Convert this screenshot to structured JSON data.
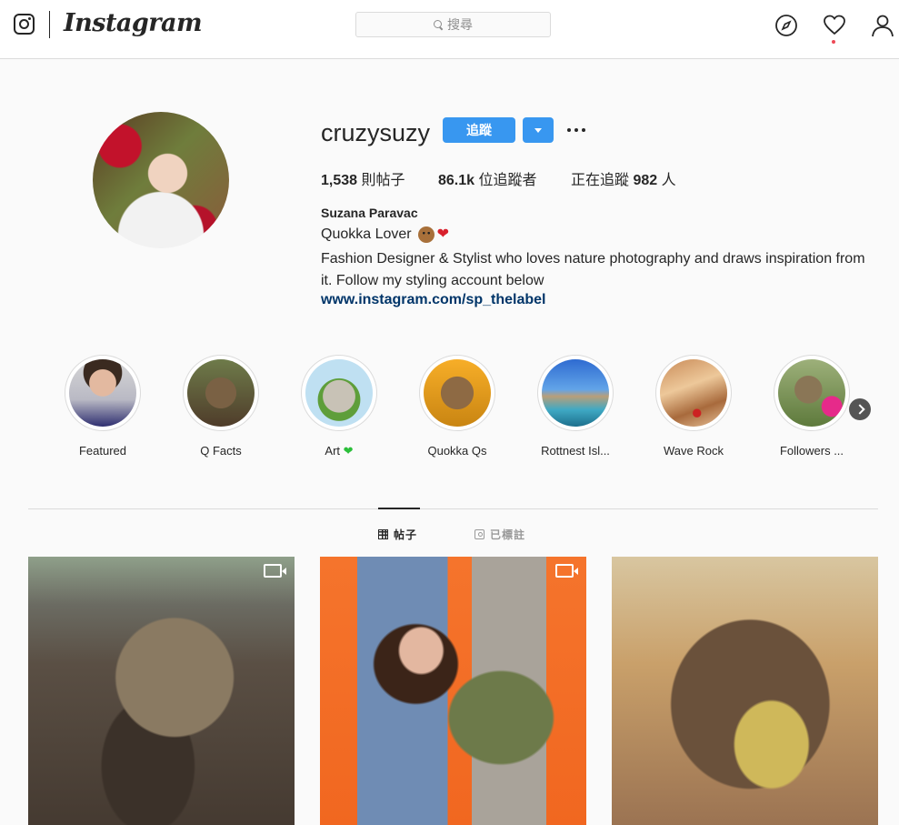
{
  "nav": {
    "brand": "Instagram",
    "search_placeholder": "搜尋"
  },
  "profile": {
    "username": "cruzysuzy",
    "follow_label": "追蹤",
    "stats": {
      "posts": "1,538",
      "posts_label": " 則帖子",
      "followers": "86.1k",
      "followers_label": " 位追蹤者",
      "following_label": "正在追蹤 ",
      "following": "982",
      "following_suffix": " 人"
    },
    "full_name": "Suzana Paravac",
    "bio_line1": "Quokka Lover",
    "bio_line2": "Fashion Designer & Stylist who loves nature photography and draws inspiration from it. Follow my styling account below",
    "link": "www.instagram.com/sp_thelabel"
  },
  "highlights": [
    {
      "label": "Featured"
    },
    {
      "label": "Q Facts"
    },
    {
      "label": "Art"
    },
    {
      "label": "Quokka Qs"
    },
    {
      "label": "Rottnest Isl..."
    },
    {
      "label": "Wave Rock"
    },
    {
      "label": "Followers ..."
    }
  ],
  "tabs": {
    "posts": "帖子",
    "tagged": "已標註"
  },
  "colors": {
    "accent": "#3897f0",
    "link": "#003569",
    "notification": "#ed4956"
  }
}
